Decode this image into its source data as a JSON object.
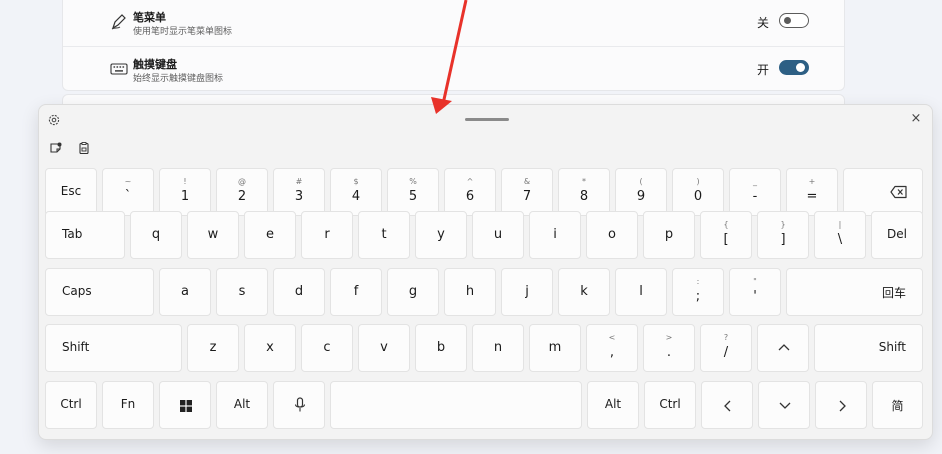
{
  "settings": {
    "rows": [
      {
        "title": "笔菜单",
        "desc": "使用笔时显示笔菜单图标",
        "state": "关"
      },
      {
        "title": "触摸键盘",
        "desc": "始终显示触摸键盘图标",
        "state": "开"
      }
    ]
  },
  "colors": {
    "arrow": "#e8322a",
    "toggle_on": "#2d5f84"
  },
  "keyboard": {
    "close": "×",
    "row1": {
      "esc": "Esc",
      "keys": [
        {
          "s": "~",
          "m": "`"
        },
        {
          "s": "!",
          "m": "1"
        },
        {
          "s": "@",
          "m": "2"
        },
        {
          "s": "#",
          "m": "3"
        },
        {
          "s": "$",
          "m": "4"
        },
        {
          "s": "%",
          "m": "5"
        },
        {
          "s": "^",
          "m": "6"
        },
        {
          "s": "&",
          "m": "7"
        },
        {
          "s": "*",
          "m": "8"
        },
        {
          "s": "(",
          "m": "9"
        },
        {
          "s": ")",
          "m": "0"
        },
        {
          "s": "_",
          "m": "-"
        },
        {
          "s": "+",
          "m": "="
        }
      ]
    },
    "row2": {
      "tab": "Tab",
      "letters": [
        "q",
        "w",
        "e",
        "r",
        "t",
        "y",
        "u",
        "i",
        "o",
        "p"
      ],
      "brackets": [
        {
          "s": "{",
          "m": "["
        },
        {
          "s": "}",
          "m": "]"
        },
        {
          "s": "|",
          "m": "\\"
        }
      ],
      "del": "Del"
    },
    "row3": {
      "caps": "Caps",
      "letters": [
        "a",
        "s",
        "d",
        "f",
        "g",
        "h",
        "j",
        "k",
        "l"
      ],
      "punct": [
        {
          "s": ":",
          "m": ";"
        },
        {
          "s": "\"",
          "m": "'"
        }
      ],
      "enter": "回车"
    },
    "row4": {
      "shift_left": "Shift",
      "letters": [
        "z",
        "x",
        "c",
        "v",
        "b",
        "n",
        "m"
      ],
      "punct": [
        {
          "s": "<",
          "m": ","
        },
        {
          "s": ">",
          "m": "."
        },
        {
          "s": "?",
          "m": "/"
        }
      ],
      "up": "^",
      "shift_right": "Shift"
    },
    "row5": {
      "ctrl_left": "Ctrl",
      "fn": "Fn",
      "alt_left": "Alt",
      "alt_right": "Alt",
      "ctrl_right": "Ctrl",
      "left": "<",
      "down": "v",
      "right": ">",
      "lang": "简"
    }
  }
}
